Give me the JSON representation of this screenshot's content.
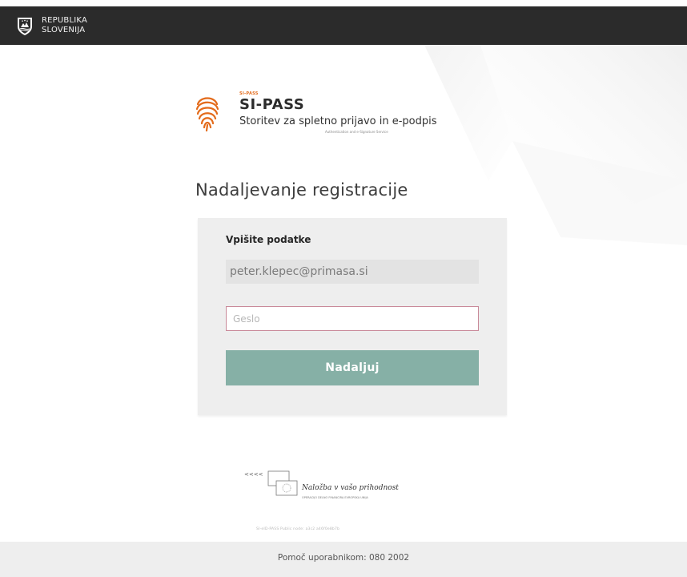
{
  "header": {
    "gov_line1": "REPUBLIKA",
    "gov_line2": "SLOVENIJA"
  },
  "brand": {
    "small_label": "SI-PASS",
    "name": "SI-PASS",
    "tagline": "Storitev za spletno prijavo in e-podpis",
    "subtagline": "Authentication and e-Signature Service",
    "accent_color": "#e36b1b"
  },
  "page": {
    "title": "Nadaljevanje registracije"
  },
  "form": {
    "heading": "Vpišite podatke",
    "email_value": "peter.klepec@primasa.si",
    "password_placeholder": "Geslo",
    "continue_label": "Nadaljuj",
    "button_color": "#86b0a6"
  },
  "eu_logo": {
    "arrows": "<<<<",
    "title": "Naložba v vašo prihodnost",
    "subtitle": "OPERACIJO DELNO FINANCIRA EVROPSKA UNIJA"
  },
  "build_id": "SI-eID-PASS Public node: a3c2 a46f0e8b7b",
  "footer": {
    "help_text": "Pomoč uporabnikom: 080 2002"
  }
}
